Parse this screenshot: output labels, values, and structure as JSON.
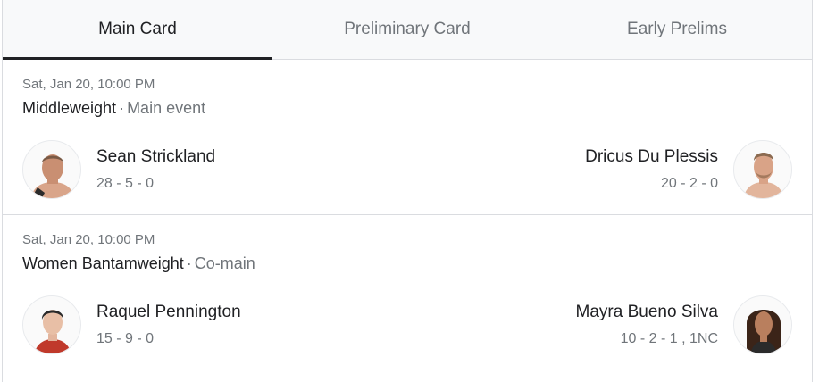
{
  "tabs": [
    {
      "label": "Main Card",
      "active": true
    },
    {
      "label": "Preliminary Card",
      "active": false
    },
    {
      "label": "Early Prelims",
      "active": false
    }
  ],
  "fights": [
    {
      "date": "Sat, Jan 20, 10:00 PM",
      "weight_class": "Middleweight",
      "separator": "·",
      "event_type": "Main event",
      "left": {
        "name": "Sean Strickland",
        "record": "28 - 5 - 0",
        "avatar": "fighter-photo"
      },
      "right": {
        "name": "Dricus Du Plessis",
        "record": "20 - 2 - 0",
        "avatar": "fighter-photo"
      }
    },
    {
      "date": "Sat, Jan 20, 10:00 PM",
      "weight_class": "Women Bantamweight",
      "separator": "·",
      "event_type": "Co-main",
      "left": {
        "name": "Raquel Pennington",
        "record": "15 - 9 - 0",
        "avatar": "fighter-photo"
      },
      "right": {
        "name": "Mayra Bueno Silva",
        "record": "10 - 2 - 1 , 1NC",
        "avatar": "fighter-photo"
      }
    }
  ],
  "colors": {
    "accent": "#202124",
    "muted": "#70757a",
    "divider": "#dadce0",
    "tab_bg": "#f8f9fa"
  }
}
